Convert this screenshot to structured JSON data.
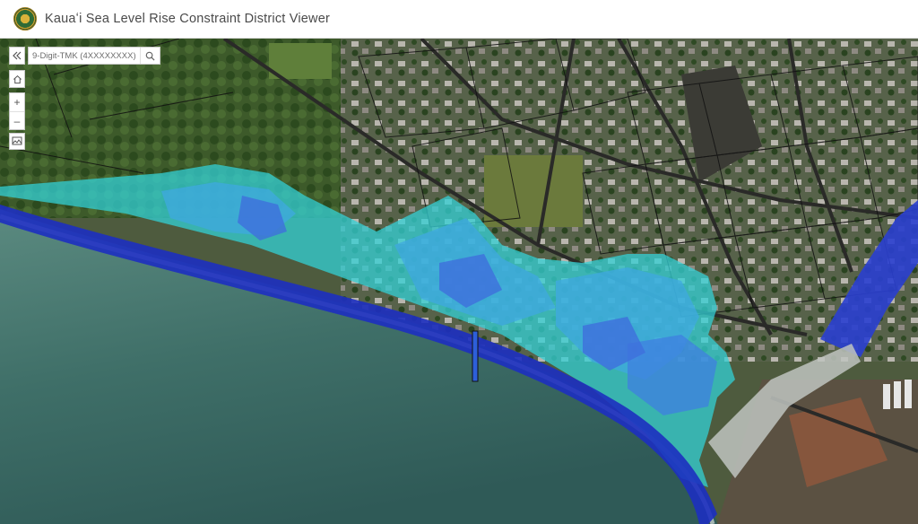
{
  "header": {
    "title": "Kauaʻi Sea Level Rise Constraint District Viewer",
    "logo_icon": "county-seal-icon"
  },
  "search": {
    "placeholder": "9-Digit-TMK (4XXXXXXXX)",
    "value": ""
  },
  "controls": {
    "collapse_icon": "double-chevron-left-icon",
    "home_icon": "home-icon",
    "zoom_in_label": "+",
    "zoom_out_label": "–",
    "basemap_icon": "basemap-gallery-icon",
    "search_icon": "search-icon"
  },
  "map": {
    "layers": [
      "satellite-imagery",
      "parcels",
      "sea-level-rise-constraint-district"
    ],
    "colors": {
      "ocean": "#3f6f68",
      "land": "#3a4a2c",
      "slr_light": "#33d0d6",
      "slr_mid": "#3fa8e0",
      "slr_deep": "#2d5fd9",
      "shore": "#1d2fc0",
      "parcel_line": "#111111"
    }
  }
}
